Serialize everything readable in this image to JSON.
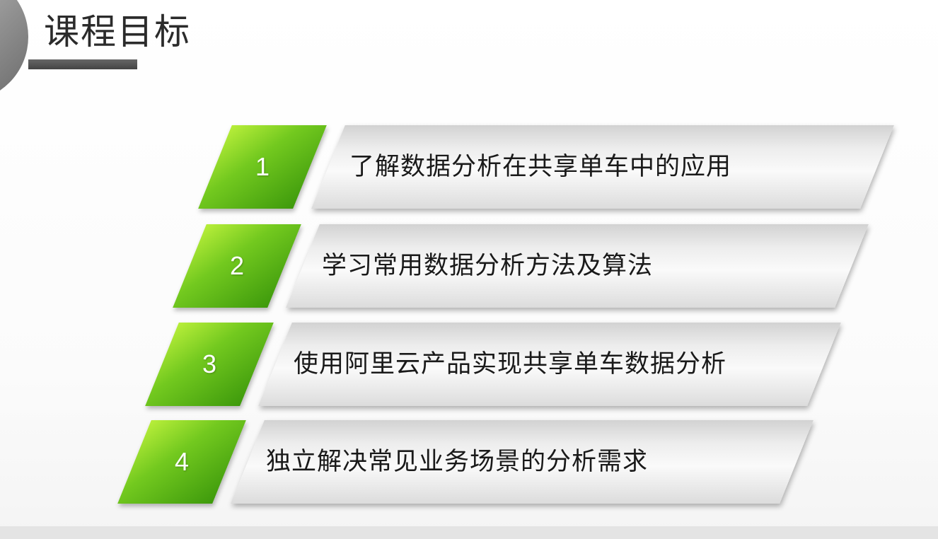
{
  "slide": {
    "title": "课程目标",
    "accent_color": "#5cb514",
    "goals": [
      {
        "number": "1",
        "text": "了解数据分析在共享单车中的应用"
      },
      {
        "number": "2",
        "text": "学习常用数据分析方法及算法"
      },
      {
        "number": "3",
        "text": "使用阿里云产品实现共享单车数据分析"
      },
      {
        "number": "4",
        "text": "独立解决常见业务场景的分析需求"
      }
    ]
  }
}
